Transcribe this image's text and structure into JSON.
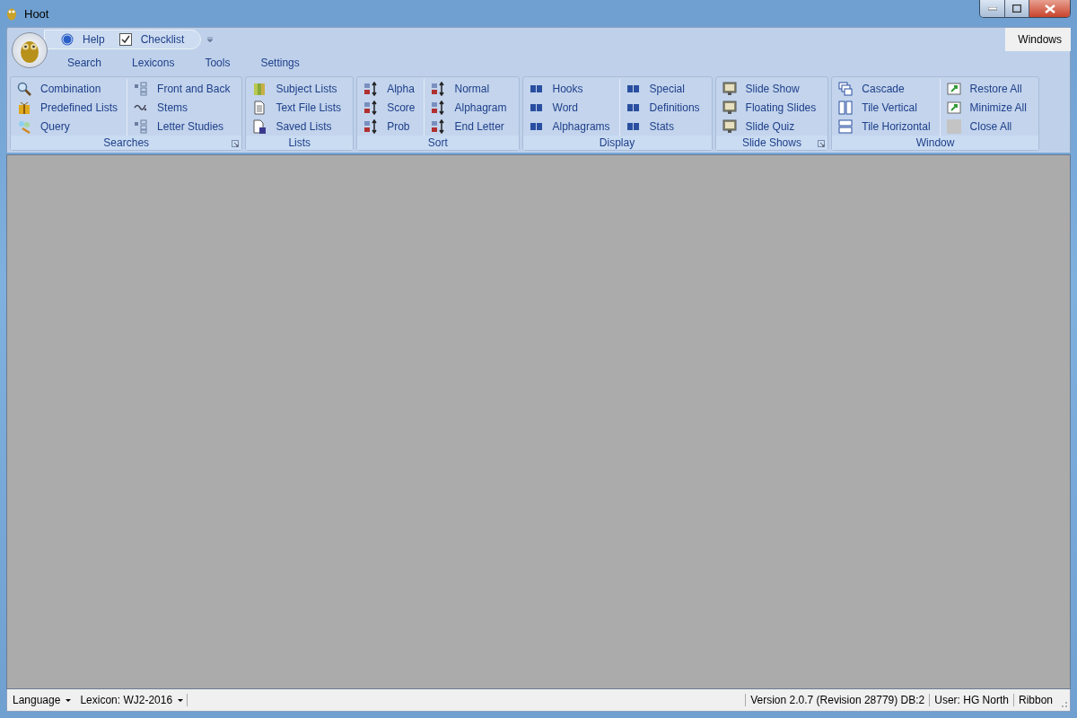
{
  "window": {
    "title": "Hoot"
  },
  "quick_access": [
    {
      "label": "Help",
      "kind": "help"
    },
    {
      "label": "Checklist",
      "kind": "check"
    }
  ],
  "ribbon_tabs": [
    {
      "label": "Search"
    },
    {
      "label": "Lexicons"
    },
    {
      "label": "Tools"
    },
    {
      "label": "Settings"
    }
  ],
  "context_tab": {
    "label": "Windows"
  },
  "groups": [
    {
      "title": "Searches",
      "launcher": true,
      "columns": [
        [
          {
            "label": "Combination"
          },
          {
            "label": "Predefined Lists"
          },
          {
            "label": "Query"
          }
        ],
        [
          {
            "label": "Front and Back"
          },
          {
            "label": "Stems"
          },
          {
            "label": "Letter Studies"
          }
        ]
      ]
    },
    {
      "title": "Lists",
      "launcher": false,
      "columns": [
        [
          {
            "label": "Subject Lists"
          },
          {
            "label": "Text File Lists"
          },
          {
            "label": "Saved Lists"
          }
        ]
      ]
    },
    {
      "title": "Sort",
      "launcher": false,
      "columns": [
        [
          {
            "label": "Alpha"
          },
          {
            "label": "Score"
          },
          {
            "label": "Prob"
          }
        ],
        [
          {
            "label": "Normal"
          },
          {
            "label": "Alphagram"
          },
          {
            "label": "End Letter"
          }
        ]
      ]
    },
    {
      "title": "Display",
      "launcher": false,
      "columns": [
        [
          {
            "label": "Hooks"
          },
          {
            "label": "Word"
          },
          {
            "label": "Alphagrams"
          }
        ],
        [
          {
            "label": "Special"
          },
          {
            "label": "Definitions"
          },
          {
            "label": "Stats"
          }
        ]
      ]
    },
    {
      "title": "Slide Shows",
      "launcher": true,
      "columns": [
        [
          {
            "label": "Slide Show"
          },
          {
            "label": "Floating Slides"
          },
          {
            "label": "Slide Quiz"
          }
        ]
      ]
    },
    {
      "title": "Window",
      "launcher": false,
      "columns": [
        [
          {
            "label": "Cascade"
          },
          {
            "label": "Tile Vertical"
          },
          {
            "label": "Tile Horizontal"
          }
        ],
        [
          {
            "label": "Restore All"
          },
          {
            "label": "Minimize All"
          },
          {
            "label": "Close All"
          }
        ]
      ]
    }
  ],
  "status_bar": {
    "left": [
      {
        "label": "Language",
        "dropdown": true
      },
      {
        "label": "Lexicon: WJ2-2016",
        "dropdown": true
      }
    ],
    "right": [
      {
        "label": "Version 2.0.7 (Revision 28779) DB:2"
      },
      {
        "label": "User: HG North"
      },
      {
        "label": "Ribbon"
      }
    ]
  }
}
